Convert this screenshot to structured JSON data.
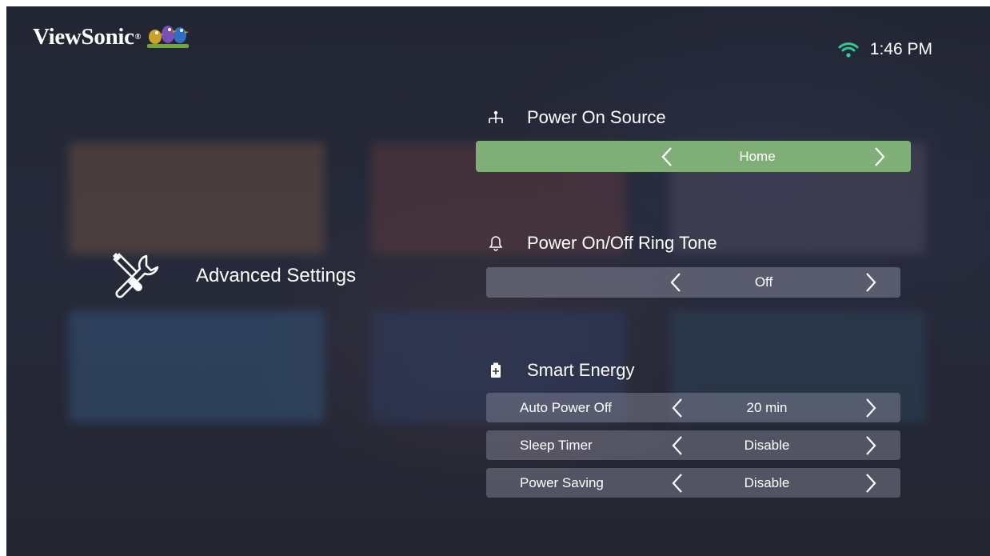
{
  "header": {
    "brand": "ViewSonic",
    "time": "1:46 PM",
    "wifi_icon": "wifi-icon"
  },
  "sidebar": {
    "title": "Advanced Settings",
    "icon": "tools-icon"
  },
  "sections": {
    "power_on_source": {
      "title": "Power On Source",
      "icon": "source-icon",
      "value": "Home",
      "selected": true
    },
    "ring_tone": {
      "title": "Power On/Off Ring Tone",
      "icon": "bell-icon",
      "value": "Off"
    },
    "smart_energy": {
      "title": "Smart Energy",
      "icon": "battery-icon",
      "rows": [
        {
          "label": "Auto Power Off",
          "value": "20 min"
        },
        {
          "label": "Sleep Timer",
          "value": "Disable"
        },
        {
          "label": "Power Saving",
          "value": "Disable"
        }
      ]
    }
  },
  "colors": {
    "selected_bar": "#80ae77",
    "accent_wifi": "#2ecc8f"
  }
}
